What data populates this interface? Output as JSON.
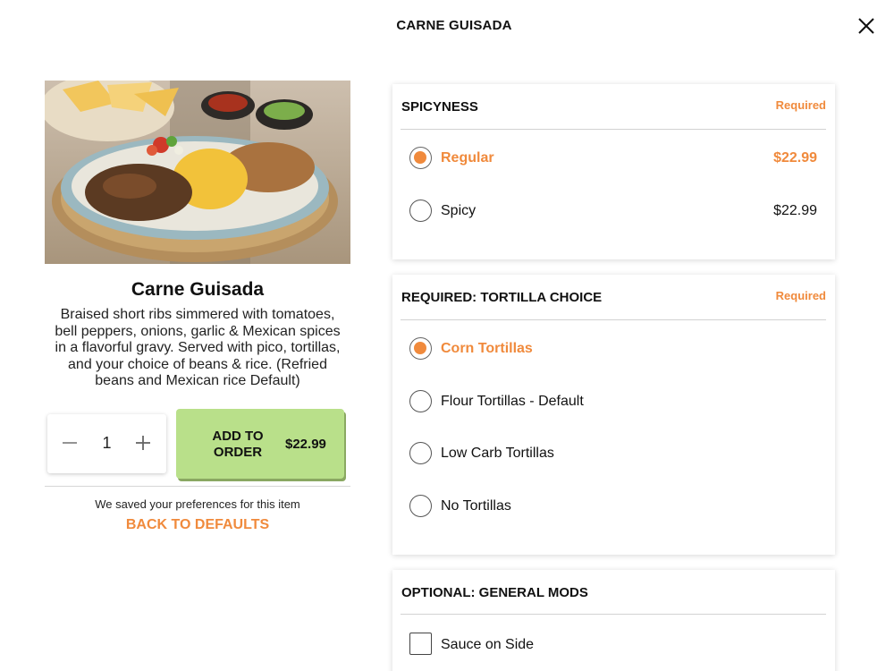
{
  "header": {
    "title": "CARNE GUISADA"
  },
  "item": {
    "name": "Carne Guisada",
    "description": "Braised short ribs simmered with tomatoes, bell peppers, onions, garlic & Mexican spices in a flavorful gravy. Served with pico, tortillas, and your choice of beans & rice. (Refried beans and Mexican rice Default)",
    "quantity": "1",
    "add_button": {
      "label": "ADD TO ORDER",
      "price": "$22.99"
    },
    "saved_note": "We saved your preferences for this item",
    "back_to_defaults": "BACK TO DEFAULTS"
  },
  "groups": [
    {
      "title": "SPICYNESS",
      "required_label": "Required",
      "options": [
        {
          "label": "Regular",
          "price": "$22.99",
          "selected": true
        },
        {
          "label": "Spicy",
          "price": "$22.99",
          "selected": false
        }
      ]
    },
    {
      "title": "REQUIRED: TORTILLA CHOICE",
      "required_label": "Required",
      "options": [
        {
          "label": "Corn Tortillas",
          "selected": true
        },
        {
          "label": "Flour Tortillas - Default",
          "selected": false
        },
        {
          "label": "Low Carb Tortillas",
          "selected": false
        },
        {
          "label": "No Tortillas",
          "selected": false
        }
      ]
    },
    {
      "title": "OPTIONAL: GENERAL MODS",
      "options": [
        {
          "label": "Sauce on Side",
          "checked": false
        }
      ]
    }
  ],
  "colors": {
    "accent": "#f08a3c",
    "add_button": "#b9e08a"
  },
  "icons": {
    "close": "close-icon",
    "minus": "minus-icon",
    "plus": "plus-icon"
  }
}
